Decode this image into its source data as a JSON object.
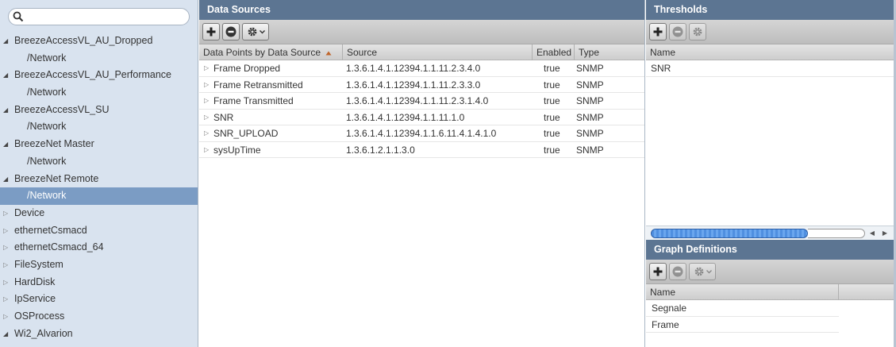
{
  "sidebar": {
    "search": {
      "placeholder": ""
    },
    "items": [
      {
        "label": "BreezeAccessVL_AU_Dropped",
        "level": 0,
        "expanded": true
      },
      {
        "label": "/Network",
        "level": 1
      },
      {
        "label": "BreezeAccessVL_AU_Performance",
        "level": 0,
        "expanded": true
      },
      {
        "label": "/Network",
        "level": 1
      },
      {
        "label": "BreezeAccessVL_SU",
        "level": 0,
        "expanded": true
      },
      {
        "label": "/Network",
        "level": 1
      },
      {
        "label": "BreezeNet Master",
        "level": 0,
        "expanded": true
      },
      {
        "label": "/Network",
        "level": 1
      },
      {
        "label": "BreezeNet Remote",
        "level": 0,
        "expanded": true
      },
      {
        "label": "/Network",
        "level": 1,
        "selected": true
      },
      {
        "label": "Device",
        "level": 0,
        "expanded": false
      },
      {
        "label": "ethernetCsmacd",
        "level": 0,
        "expanded": false
      },
      {
        "label": "ethernetCsmacd_64",
        "level": 0,
        "expanded": false
      },
      {
        "label": "FileSystem",
        "level": 0,
        "expanded": false
      },
      {
        "label": "HardDisk",
        "level": 0,
        "expanded": false
      },
      {
        "label": "IpService",
        "level": 0,
        "expanded": false
      },
      {
        "label": "OSProcess",
        "level": 0,
        "expanded": false
      },
      {
        "label": "Wi2_Alvarion",
        "level": 0,
        "expanded": true
      }
    ]
  },
  "data_sources": {
    "title": "Data Sources",
    "columns": {
      "name": "Data Points by Data Source",
      "source": "Source",
      "enabled": "Enabled",
      "type": "Type"
    },
    "rows": [
      {
        "name": "Frame Dropped",
        "source": "1.3.6.1.4.1.12394.1.1.11.2.3.4.0",
        "enabled": "true",
        "type": "SNMP"
      },
      {
        "name": "Frame Retransmitted",
        "source": "1.3.6.1.4.1.12394.1.1.11.2.3.3.0",
        "enabled": "true",
        "type": "SNMP"
      },
      {
        "name": "Frame Transmitted",
        "source": "1.3.6.1.4.1.12394.1.1.11.2.3.1.4.0",
        "enabled": "true",
        "type": "SNMP"
      },
      {
        "name": "SNR",
        "source": "1.3.6.1.4.1.12394.1.1.11.1.0",
        "enabled": "true",
        "type": "SNMP"
      },
      {
        "name": "SNR_UPLOAD",
        "source": "1.3.6.1.4.1.12394.1.1.6.11.4.1.4.1.0",
        "enabled": "true",
        "type": "SNMP"
      },
      {
        "name": "sysUpTime",
        "source": "1.3.6.1.2.1.1.3.0",
        "enabled": "true",
        "type": "SNMP"
      }
    ]
  },
  "thresholds": {
    "title": "Thresholds",
    "column": "Name",
    "rows": [
      "SNR"
    ]
  },
  "graph_definitions": {
    "title": "Graph Definitions",
    "column": "Name",
    "rows": [
      "Segnale",
      "Frame"
    ]
  },
  "colors": {
    "panel_header": "#5c7592",
    "sidebar_bg": "#d9e3ef",
    "selected_row": "#7b9cc4"
  }
}
